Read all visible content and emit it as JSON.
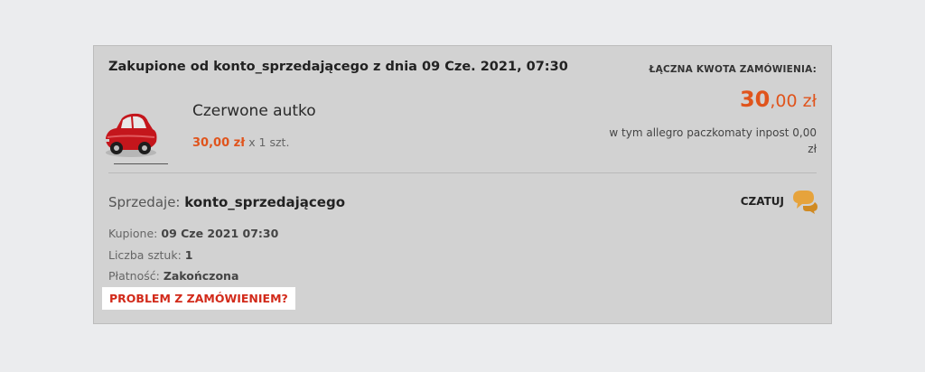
{
  "order": {
    "header_title": "Zakupione od konto_sprzedającego z dnia 09 Cze. 2021, 07:30",
    "total_label": "Łączna kwota zamówienia:",
    "total_amount_int": "30",
    "total_amount_rest": ",00 zł",
    "total_note": "w tym allegro paczkomaty inpost 0,00 zł"
  },
  "product": {
    "name": "Czerwone autko",
    "price": "30,00 zł",
    "quantity": "x 1 szt.",
    "image_icon": "red-toy-car-icon"
  },
  "seller": {
    "label": "Sprzedaje:",
    "name": "konto_sprzedającego"
  },
  "chat": {
    "label": "CZATUJ",
    "icon": "chat-bubbles-icon",
    "color": "#e6a33c"
  },
  "details": {
    "purchased_label": "Kupione:",
    "purchased_value": "09 Cze 2021 07:30",
    "count_label": "Liczba sztuk:",
    "count_value": "1",
    "payment_label": "Płatność:",
    "payment_value": "Zakończona"
  },
  "problem_link": "PROBLEM Z ZAMÓWIENIEM?",
  "colors": {
    "accent": "#e0541c",
    "problem": "#d22a1a",
    "card_bg": "#d2d2d2",
    "page_bg": "#ebecee"
  }
}
